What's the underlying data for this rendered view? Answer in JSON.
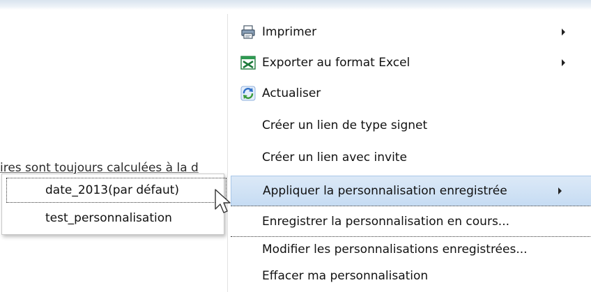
{
  "background": {
    "partial_text": "ires sont toujours calculées à la d"
  },
  "context_menu": {
    "items": [
      {
        "label": "Imprimer",
        "icon": "printer-icon",
        "has_submenu": true
      },
      {
        "label": "Exporter au format Excel",
        "icon": "excel-icon",
        "has_submenu": true
      },
      {
        "label": "Actualiser",
        "icon": "refresh-icon",
        "has_submenu": false
      },
      {
        "label": "Créer un lien de type signet",
        "icon": "",
        "has_submenu": false
      },
      {
        "label": "Créer un lien avec invite",
        "icon": "",
        "has_submenu": false
      },
      {
        "label": "Appliquer la personnalisation enregistrée",
        "icon": "",
        "has_submenu": true,
        "highlighted": true
      },
      {
        "label": "Enregistrer la personnalisation en cours...",
        "icon": "",
        "has_submenu": false
      },
      {
        "label": "Modifier les personnalisations enregistrées...",
        "icon": "",
        "has_submenu": false
      },
      {
        "label": "Effacer ma personnalisation",
        "icon": "",
        "has_submenu": false
      }
    ]
  },
  "submenu": {
    "items": [
      {
        "label": "date_2013(par défaut)",
        "active": true
      },
      {
        "label": "test_personnalisation",
        "active": false
      }
    ]
  },
  "colors": {
    "highlight": "#c6dcf3",
    "highlight_border": "#a9c7e8",
    "excel_green": "#1e7a3c",
    "refresh_blue": "#2f6fc6"
  }
}
